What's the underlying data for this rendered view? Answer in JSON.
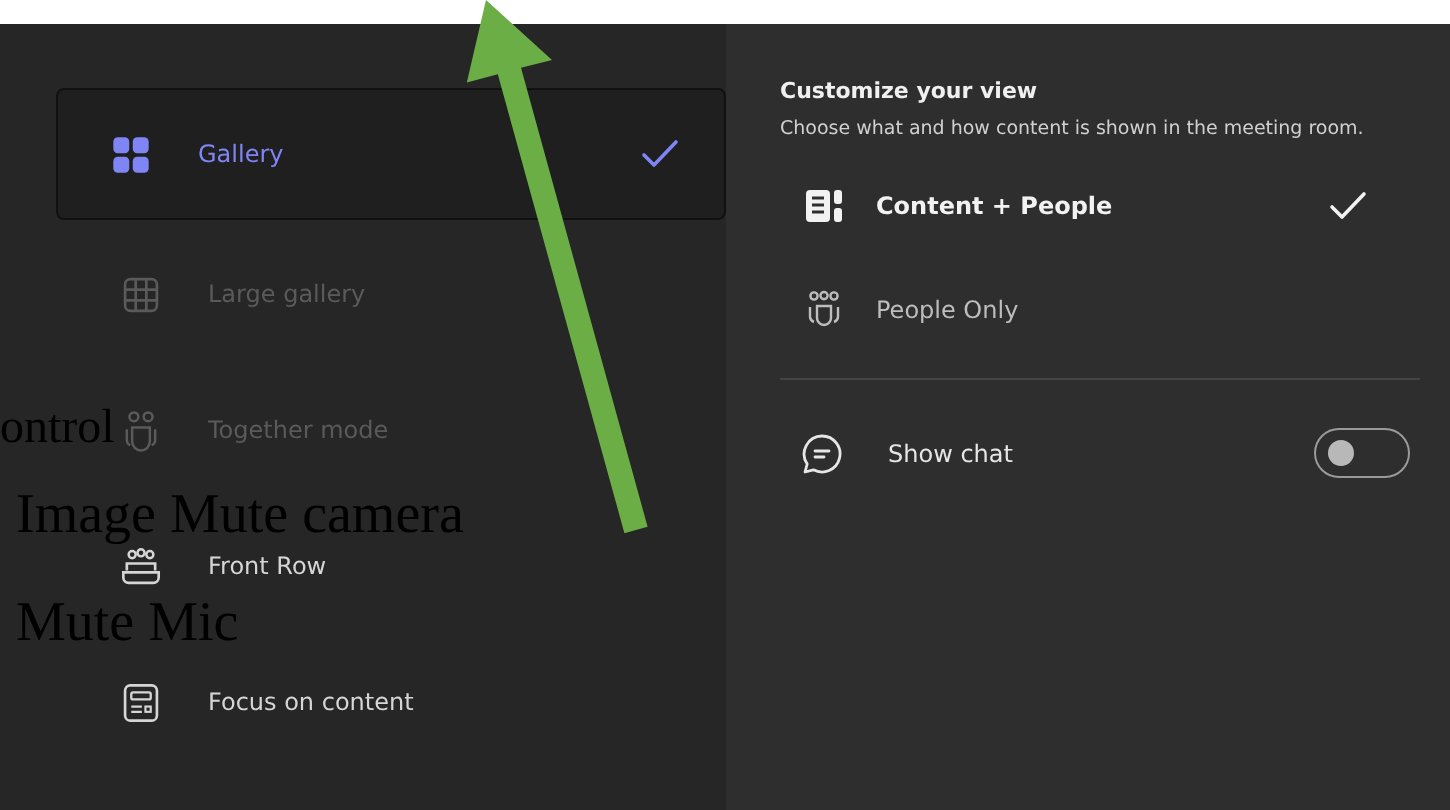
{
  "view_options": [
    {
      "label": "Gallery",
      "selected": true,
      "disabled": false
    },
    {
      "label": "Large gallery",
      "selected": false,
      "disabled": true
    },
    {
      "label": "Together mode",
      "selected": false,
      "disabled": true
    },
    {
      "label": "Front Row",
      "selected": false,
      "disabled": false
    },
    {
      "label": "Focus on content",
      "selected": false,
      "disabled": false
    }
  ],
  "customize": {
    "title": "Customize your view",
    "description": "Choose what and how content is shown in the meeting room.",
    "layouts": [
      {
        "label": "Content + People",
        "selected": true
      },
      {
        "label": "People Only",
        "selected": false
      }
    ],
    "show_chat": {
      "label": "Show chat",
      "on": false
    }
  },
  "overlay_text": [
    "ontrol",
    "Image Mute camera",
    "Mute Mic"
  ]
}
